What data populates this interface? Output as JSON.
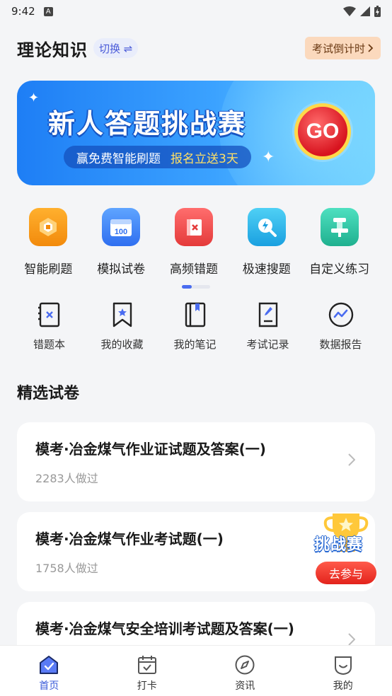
{
  "status_bar": {
    "time": "9:42",
    "notif_letter": "A"
  },
  "header": {
    "title": "理论知识",
    "switch_label": "切换 ⇌",
    "countdown_label": "考试倒计时"
  },
  "banner": {
    "title": "新人答题挑战赛",
    "subtitle_left": "赢免费智能刷题",
    "subtitle_right": "报名立送3天",
    "go_label": "GO"
  },
  "quick_actions": [
    {
      "label": "智能刷题",
      "icon": "smart-practice-icon",
      "color": "#f7a21c"
    },
    {
      "label": "模拟试卷",
      "icon": "mock-exam-icon",
      "color": "#3b82f6"
    },
    {
      "label": "高频错题",
      "icon": "frequent-mistakes-icon",
      "color": "#ef4444"
    },
    {
      "label": "极速搜题",
      "icon": "quick-search-icon",
      "color": "#22b3e8"
    },
    {
      "label": "自定义练习",
      "icon": "custom-practice-icon",
      "color": "#2cc6a8"
    }
  ],
  "tools": [
    {
      "label": "错题本",
      "icon": "mistake-book-icon"
    },
    {
      "label": "我的收藏",
      "icon": "favorites-icon"
    },
    {
      "label": "我的笔记",
      "icon": "notes-icon"
    },
    {
      "label": "考试记录",
      "icon": "exam-record-icon"
    },
    {
      "label": "数据报告",
      "icon": "data-report-icon"
    }
  ],
  "section": {
    "title": "精选试卷"
  },
  "papers": [
    {
      "title": "模考·冶金煤气作业证试题及答案(一)",
      "count": "2283人做过"
    },
    {
      "title": "模考·冶金煤气作业考试题(一)",
      "count": "1758人做过"
    },
    {
      "title": "模考·冶金煤气安全培训考试题及答案(一)",
      "count": ""
    }
  ],
  "challenge_float": {
    "title": "挑战赛",
    "button": "去参与"
  },
  "bottom_nav": [
    {
      "label": "首页",
      "icon": "home-icon",
      "active": true
    },
    {
      "label": "打卡",
      "icon": "calendar-checkin-icon",
      "active": false
    },
    {
      "label": "资讯",
      "icon": "compass-icon",
      "active": false
    },
    {
      "label": "我的",
      "icon": "profile-icon",
      "active": false
    }
  ],
  "colors": {
    "accent": "#3a5bd9",
    "countdown_bg": "#fbd9bd",
    "banner_blue": "#1e7ef5",
    "go_red": "#d8141f"
  }
}
